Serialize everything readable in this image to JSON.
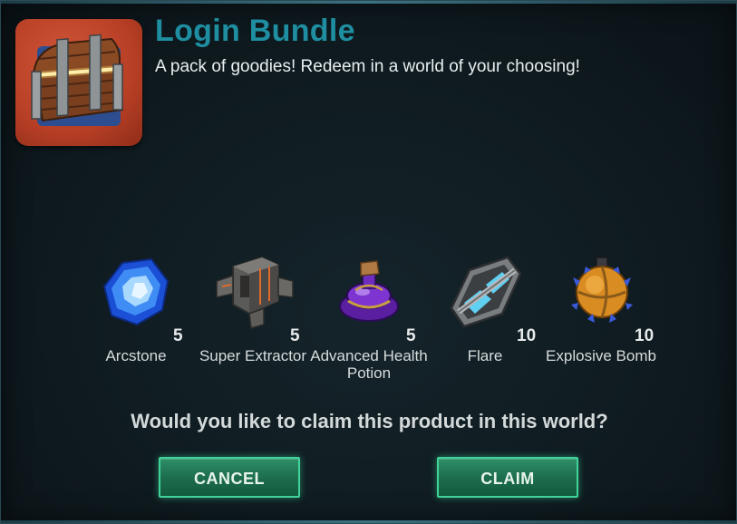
{
  "bundle": {
    "icon": "treasure-chest-icon",
    "title": "Login Bundle",
    "subtitle": "A pack of goodies! Redeem in a world of your choosing!"
  },
  "items": [
    {
      "name": "Arcstone",
      "quantity": "5",
      "icon": "arcstone-icon"
    },
    {
      "name": "Super Extractor",
      "quantity": "5",
      "icon": "super-extractor-icon"
    },
    {
      "name": "Advanced Health Potion",
      "quantity": "5",
      "icon": "health-potion-icon"
    },
    {
      "name": "Flare",
      "quantity": "10",
      "icon": "flare-icon"
    },
    {
      "name": "Explosive Bomb",
      "quantity": "10",
      "icon": "explosive-bomb-icon"
    }
  ],
  "prompt": "Would you like to claim this product in this world?",
  "buttons": {
    "cancel": "CANCEL",
    "claim": "CLAIM"
  },
  "colors": {
    "title": "#1e8ea0",
    "button": "#1d6e4e",
    "button_border": "#3fd39a",
    "icon_bg": "#b73f25"
  }
}
